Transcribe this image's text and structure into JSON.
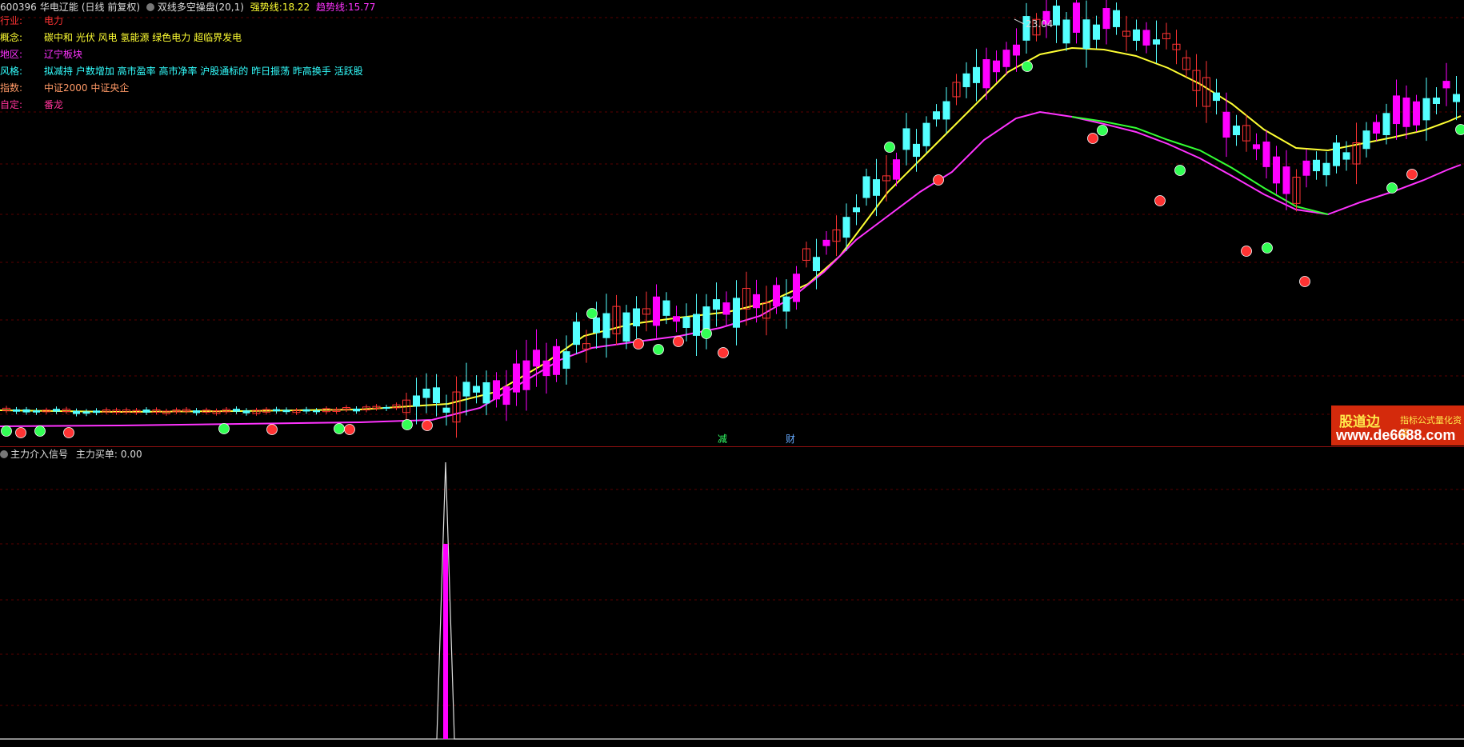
{
  "header": {
    "stock_code": "600396",
    "stock_name": "华电辽能",
    "period_info": "(日线 前复权)",
    "indicator_name": "双线多空操盘(20,1)",
    "strong_label": "强势线:",
    "strong_value": "18.22",
    "trend_label": "趋势线:",
    "trend_value": "15.77"
  },
  "info_rows": [
    {
      "label": "行业:",
      "value": "电力",
      "color": "#ff3333"
    },
    {
      "label": "概念:",
      "value": "碳中和 光伏 风电 氢能源 绿色电力 超临界发电",
      "color": "#ffff33"
    },
    {
      "label": "地区:",
      "value": "辽宁板块",
      "color": "#ff33ff"
    },
    {
      "label": "风格:",
      "value": "拟减持 户数增加 高市盈率 高市净率 沪股通标的 昨日振荡 昨高换手 活跃股",
      "color": "#33ffff"
    },
    {
      "label": "指数:",
      "value": "中证2000 中证央企",
      "color": "#ff9966"
    },
    {
      "label": "自定:",
      "value": "番龙",
      "color": "#ff3399"
    }
  ],
  "chart_markers": {
    "peak_label": "23.04",
    "event_markers": [
      "减",
      "财"
    ]
  },
  "sub_panel": {
    "title": "主力介入信号",
    "buy_label": "主力买单:",
    "buy_value": "0.00"
  },
  "watermark": {
    "brand": "股道边",
    "tagline": "指标公式量化资源",
    "url": "www.de6688.com"
  },
  "colors": {
    "up_candle": "#ff3333",
    "up_candle_strong": "#ff00ff",
    "down_candle": "#54ffff",
    "strong_line": "#ffff33",
    "trend_line": "#ff33ff",
    "bear_line": "#33ff33",
    "gridline": "#5a0000"
  },
  "chart_data": {
    "type": "candlestick",
    "price_high_label": 23.04,
    "series": [
      {
        "name": "强势线",
        "current": 18.22
      },
      {
        "name": "趋势线",
        "current": 15.77
      }
    ],
    "signals": [
      "多",
      "空"
    ],
    "sub_series": {
      "name": "主力买单",
      "current": 0.0
    }
  }
}
